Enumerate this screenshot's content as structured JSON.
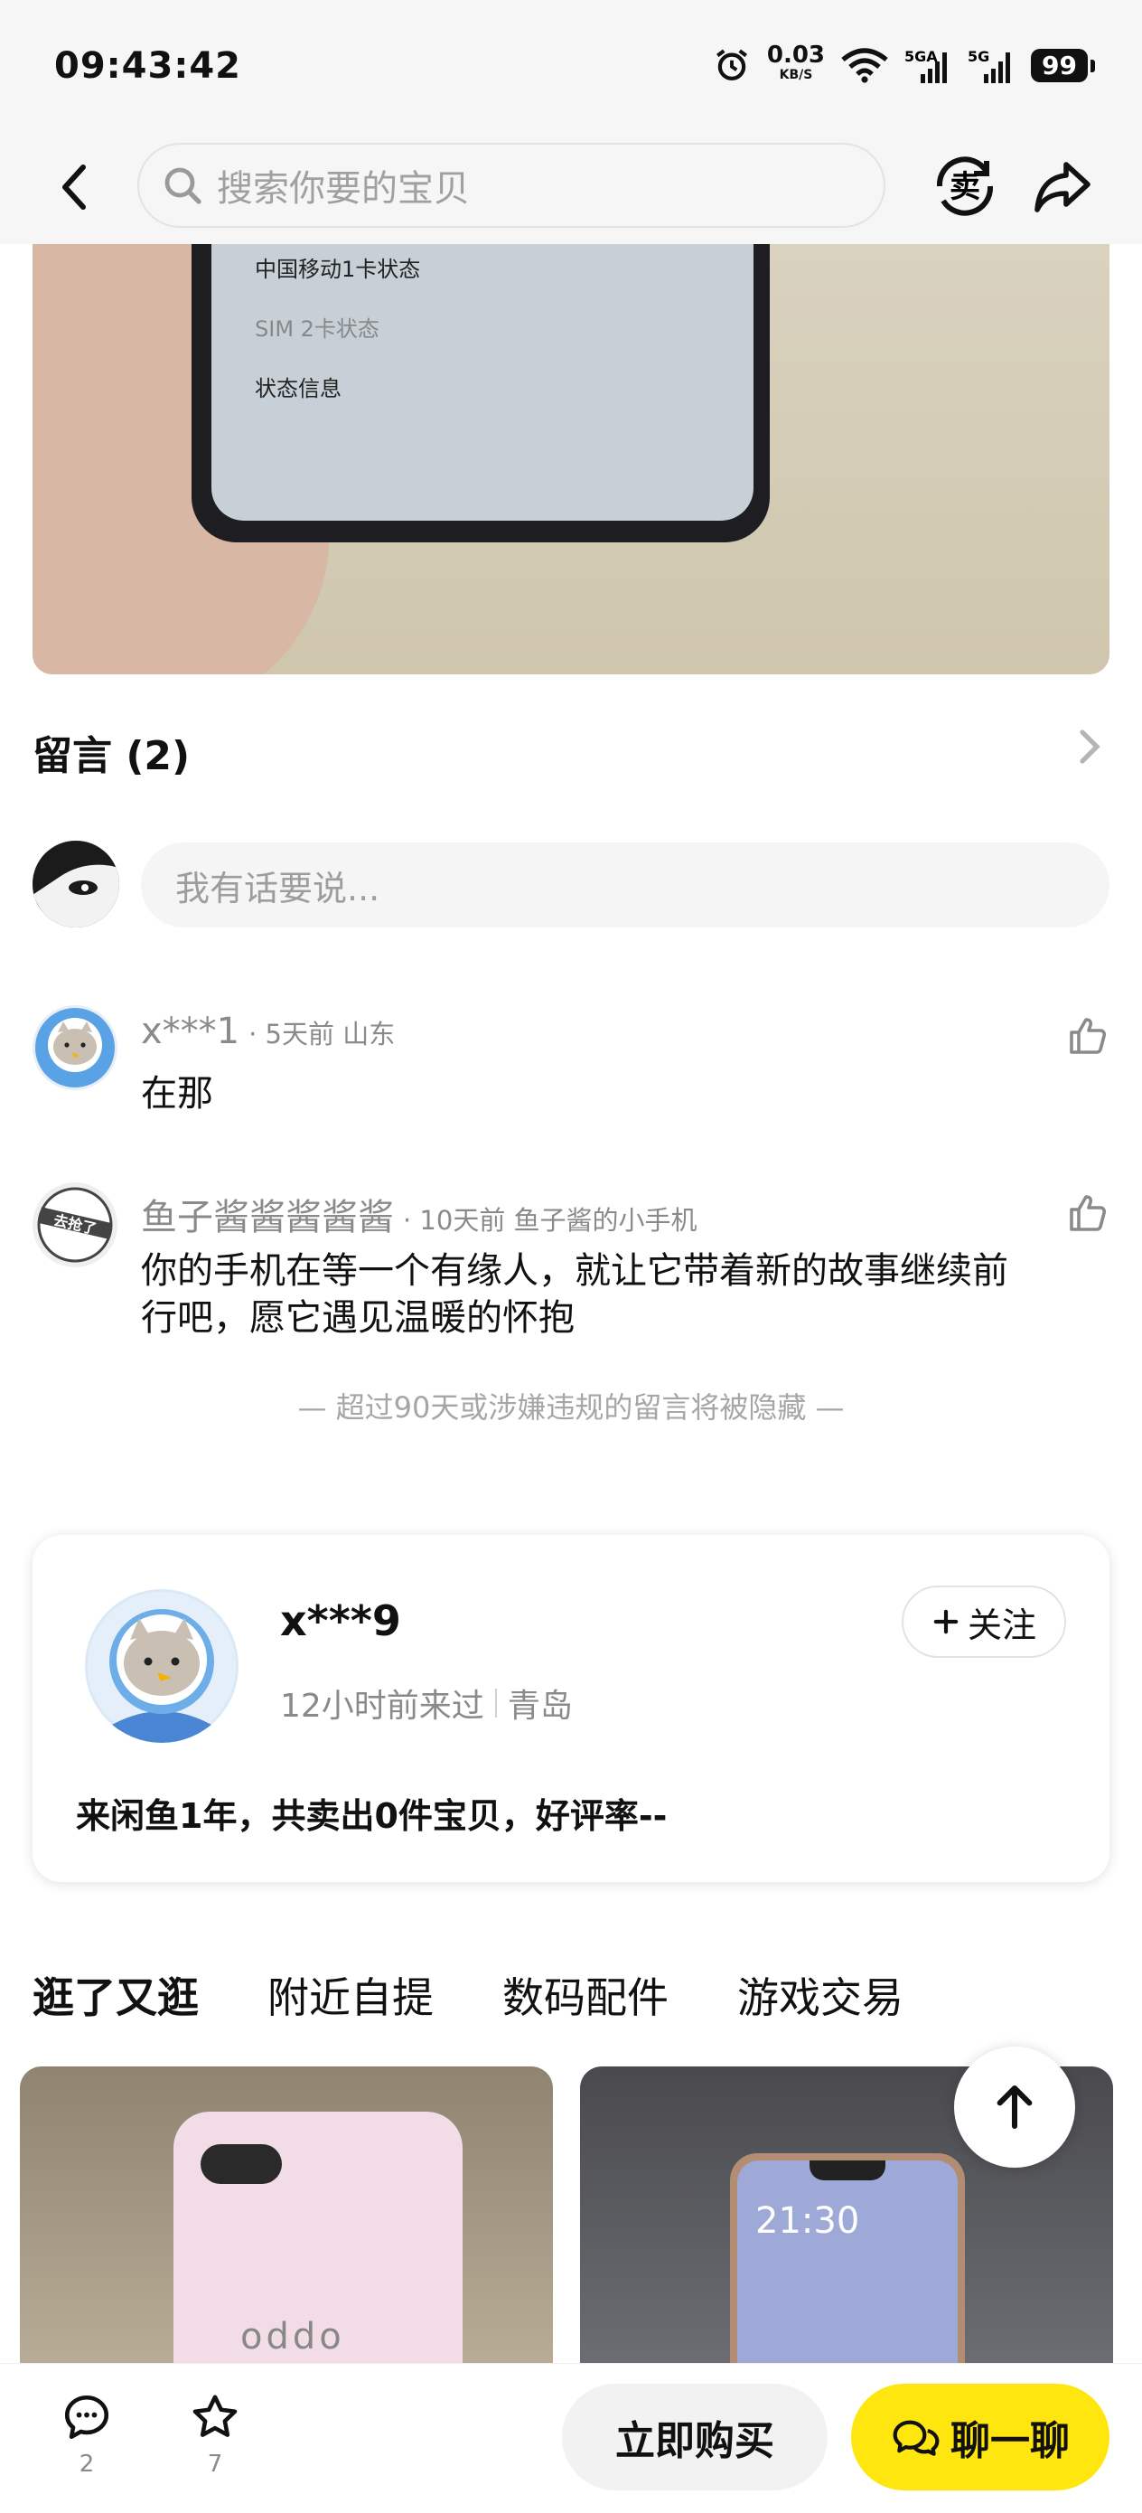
{
  "status_bar": {
    "time": "09:43:42",
    "net_speed_value": "0.03",
    "net_speed_unit": "KB/S",
    "signal_1_label": "5GA",
    "signal_2_label": "5G",
    "battery": "99"
  },
  "header": {
    "search_placeholder": "搜索你要的宝贝",
    "sell_icon_char": "卖"
  },
  "photo": {
    "screen_lines": [
      "中国移动1卡状态",
      "SIM 2卡状态",
      "状态信息"
    ]
  },
  "comments": {
    "title": "留言 (2)",
    "input_placeholder": "我有话要说...",
    "items": [
      {
        "user": "x***1",
        "meta": "· 5天前  山东",
        "text": "在那"
      },
      {
        "user": "鱼子酱酱酱酱酱",
        "meta": "· 10天前  鱼子酱的小手机",
        "text": "你的手机在等一个有缘人，就让它带着新的故事继续前行吧，愿它遇见温暖的怀抱",
        "avatar_badge": "去抢了"
      }
    ],
    "hidden_note": "— 超过90天或涉嫌违规的留言将被隐藏 —"
  },
  "seller": {
    "name": "x***9",
    "last_seen": "12小时前来过",
    "location": "青岛",
    "follow_label": "关注",
    "stats": "来闲鱼1年，共卖出0件宝贝，好评率--"
  },
  "tabs": [
    {
      "label": "逛了又逛",
      "active": true
    },
    {
      "label": "附近自提",
      "active": false
    },
    {
      "label": "数码配件",
      "active": false
    },
    {
      "label": "游戏交易",
      "active": false
    }
  ],
  "cards": {
    "card_1_brand": "oppo",
    "card_2_time": "21:30"
  },
  "bottom_bar": {
    "comment_count": "2",
    "favorite_count": "7",
    "buy_label": "立即购买",
    "chat_label": "聊一聊"
  },
  "colors": {
    "accent_yellow": "#ffe60f",
    "tab_highlight": "#ffe33a"
  }
}
